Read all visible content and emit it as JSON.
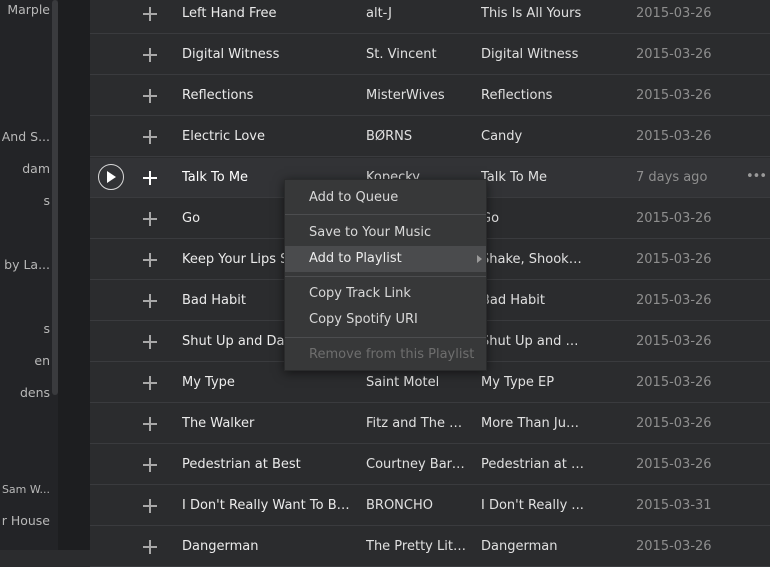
{
  "sidebar": {
    "items": [
      {
        "label": "Marple"
      },
      {
        "label": "And S..."
      },
      {
        "label": "dam"
      },
      {
        "label": "s"
      },
      {
        "label": "by La..."
      },
      {
        "label": "s"
      },
      {
        "label": "en"
      },
      {
        "label": "dens"
      },
      {
        "label": "Sam W..."
      },
      {
        "label": "r House"
      }
    ]
  },
  "tracks": [
    {
      "title": "Left Hand Free",
      "artist": "alt-J",
      "album": "This Is All Yours",
      "date": "2015-03-26"
    },
    {
      "title": "Digital Witness",
      "artist": "St. Vincent",
      "album": "Digital Witness",
      "date": "2015-03-26"
    },
    {
      "title": "Reflections",
      "artist": "MisterWives",
      "album": "Reflections",
      "date": "2015-03-26"
    },
    {
      "title": "Electric Love",
      "artist": "BØRNS",
      "album": "Candy",
      "date": "2015-03-26"
    },
    {
      "title": "Talk To Me",
      "artist": "Kopecky",
      "album": "Talk To Me",
      "date": "7 days ago",
      "more": "•••"
    },
    {
      "title": "Go",
      "artist": "",
      "album": "Go",
      "date": "2015-03-26"
    },
    {
      "title": "Keep Your Lips S",
      "artist": "",
      "album": "Shake, Shook, ...",
      "date": "2015-03-26"
    },
    {
      "title": "Bad Habit",
      "artist": "",
      "album": "Bad Habit",
      "date": "2015-03-26"
    },
    {
      "title": "Shut Up and Dan",
      "artist": "",
      "album": "Shut Up and D...",
      "date": "2015-03-26"
    },
    {
      "title": "My Type",
      "artist": "Saint Motel",
      "album": "My Type EP",
      "date": "2015-03-26"
    },
    {
      "title": "The Walker",
      "artist": "Fitz and The T...",
      "album": "More Than Jus...",
      "date": "2015-03-26"
    },
    {
      "title": "Pedestrian at Best",
      "artist": "Courtney Barn...",
      "album": "Pedestrian at B...",
      "date": "2015-03-26"
    },
    {
      "title": "I Don't Really Want To Be ...",
      "artist": "BRONCHO",
      "album": "I Don't Really ...",
      "date": "2015-03-31"
    },
    {
      "title": "Dangerman",
      "artist": "The Pretty Littles",
      "album": "Dangerman",
      "date": "2015-03-26"
    }
  ],
  "context_menu": {
    "items": [
      {
        "label": "Add to Queue"
      },
      {
        "label": "Save to Your Music"
      },
      {
        "label": "Add to Playlist"
      },
      {
        "label": "Copy Track Link"
      },
      {
        "label": "Copy Spotify URI"
      },
      {
        "label": "Remove from this Playlist"
      }
    ]
  }
}
